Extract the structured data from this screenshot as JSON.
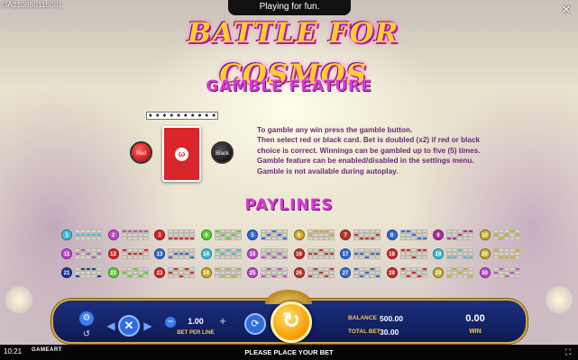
{
  "header": {
    "game_id": "GA210880116081",
    "fun_banner": "Playing for fun.",
    "close_symbol": "✕",
    "logo_text": "BATTLE FOR COSMOS"
  },
  "gamble": {
    "title": "GAMBLE FEATURE",
    "card_strip": [
      "♠",
      "♠",
      "♠",
      "♠",
      "♠",
      "♠",
      "♠",
      "♠",
      "♠",
      "♠"
    ],
    "red_label": "Red",
    "black_label": "Black",
    "card_logo": "ω",
    "lines": [
      "To gamble any win press the gamble button.",
      "Then select red or black card. Bet is doubled (x2) if red or black",
      "choice is correct. Winnings can be gambled up to five (5) times.",
      "Gamble feature can be enabled/disabled in the settings menu.",
      "Gamble is not available during autoplay."
    ]
  },
  "paylines": {
    "title": "PAYLINES",
    "lines": [
      {
        "n": "1",
        "color": "#3fc2d9",
        "rows": [
          1,
          1,
          1,
          1,
          1
        ]
      },
      {
        "n": "2",
        "color": "#c04ad0",
        "rows": [
          0,
          0,
          0,
          0,
          0
        ]
      },
      {
        "n": "3",
        "color": "#d6262a",
        "rows": [
          2,
          2,
          2,
          2,
          2
        ]
      },
      {
        "n": "4",
        "color": "#5fcf3a",
        "rows": [
          0,
          1,
          2,
          1,
          0
        ]
      },
      {
        "n": "5",
        "color": "#2f6ce0",
        "rows": [
          2,
          1,
          0,
          1,
          2
        ]
      },
      {
        "n": "6",
        "color": "#d6a92a",
        "rows": [
          1,
          0,
          0,
          0,
          1
        ]
      },
      {
        "n": "7",
        "color": "#c0362a",
        "rows": [
          1,
          2,
          2,
          2,
          1
        ]
      },
      {
        "n": "8",
        "color": "#2f6ce0",
        "rows": [
          0,
          0,
          1,
          2,
          2
        ]
      },
      {
        "n": "9",
        "color": "#a8329a",
        "rows": [
          2,
          2,
          1,
          0,
          0
        ]
      },
      {
        "n": "10",
        "color": "#c8b02a",
        "rows": [
          1,
          2,
          1,
          0,
          1
        ]
      },
      {
        "n": "11",
        "color": "#c04ad0",
        "rows": [
          1,
          0,
          1,
          2,
          1
        ]
      },
      {
        "n": "12",
        "color": "#d6262a",
        "rows": [
          0,
          1,
          1,
          1,
          0
        ]
      },
      {
        "n": "13",
        "color": "#2f6ce0",
        "rows": [
          2,
          1,
          1,
          1,
          2
        ]
      },
      {
        "n": "14",
        "color": "#3fc2d9",
        "rows": [
          0,
          1,
          0,
          1,
          0
        ]
      },
      {
        "n": "15",
        "color": "#c04ad0",
        "rows": [
          2,
          1,
          2,
          1,
          2
        ]
      },
      {
        "n": "16",
        "color": "#c0362a",
        "rows": [
          1,
          1,
          0,
          1,
          1
        ]
      },
      {
        "n": "17",
        "color": "#2f6ce0",
        "rows": [
          1,
          1,
          2,
          1,
          1
        ]
      },
      {
        "n": "18",
        "color": "#d6262a",
        "rows": [
          0,
          0,
          2,
          0,
          0
        ]
      },
      {
        "n": "19",
        "color": "#3fc2d9",
        "rows": [
          2,
          2,
          0,
          2,
          2
        ]
      },
      {
        "n": "20",
        "color": "#c8b02a",
        "rows": [
          0,
          2,
          2,
          2,
          0
        ]
      },
      {
        "n": "21",
        "color": "#1a3aa0",
        "rows": [
          2,
          0,
          0,
          0,
          2
        ]
      },
      {
        "n": "22",
        "color": "#5fcf3a",
        "rows": [
          1,
          2,
          0,
          2,
          1
        ]
      },
      {
        "n": "23",
        "color": "#d6262a",
        "rows": [
          1,
          0,
          2,
          0,
          1
        ]
      },
      {
        "n": "24",
        "color": "#c8b02a",
        "rows": [
          0,
          2,
          0,
          2,
          0
        ]
      },
      {
        "n": "25",
        "color": "#c04ad0",
        "rows": [
          2,
          0,
          2,
          0,
          2
        ]
      },
      {
        "n": "26",
        "color": "#c0362a",
        "rows": [
          2,
          0,
          1,
          2,
          0
        ]
      },
      {
        "n": "27",
        "color": "#2f6ce0",
        "rows": [
          0,
          2,
          1,
          0,
          2
        ]
      },
      {
        "n": "28",
        "color": "#d6262a",
        "rows": [
          0,
          2,
          1,
          2,
          0
        ]
      },
      {
        "n": "29",
        "color": "#c8b02a",
        "rows": [
          2,
          0,
          1,
          0,
          2
        ]
      },
      {
        "n": "30",
        "color": "#c04ad0",
        "rows": [
          1,
          0,
          2,
          1,
          0
        ]
      }
    ]
  },
  "controls": {
    "settings_icon": "⚙",
    "history_icon": "↺",
    "nav_left": "◀",
    "nav_right": "▶",
    "close_symbol": "✕",
    "minus_symbol": "−",
    "plus_symbol": "+",
    "bet_value": "1.00",
    "bet_label": "BET PER LINE",
    "autoplay_icon": "⟳",
    "spin_icon": "↻",
    "balance_label": "BALANCE",
    "balance_value": "500.00",
    "total_bet_label": "TOTAL BET",
    "total_bet_value": "30.00",
    "win_value": "0.00",
    "win_label": "WIN"
  },
  "footer": {
    "clock": "10:21",
    "brand": "GAMEART",
    "status": "PLEASE PLACE YOUR BET",
    "fullscreen_icon": "⛶"
  }
}
